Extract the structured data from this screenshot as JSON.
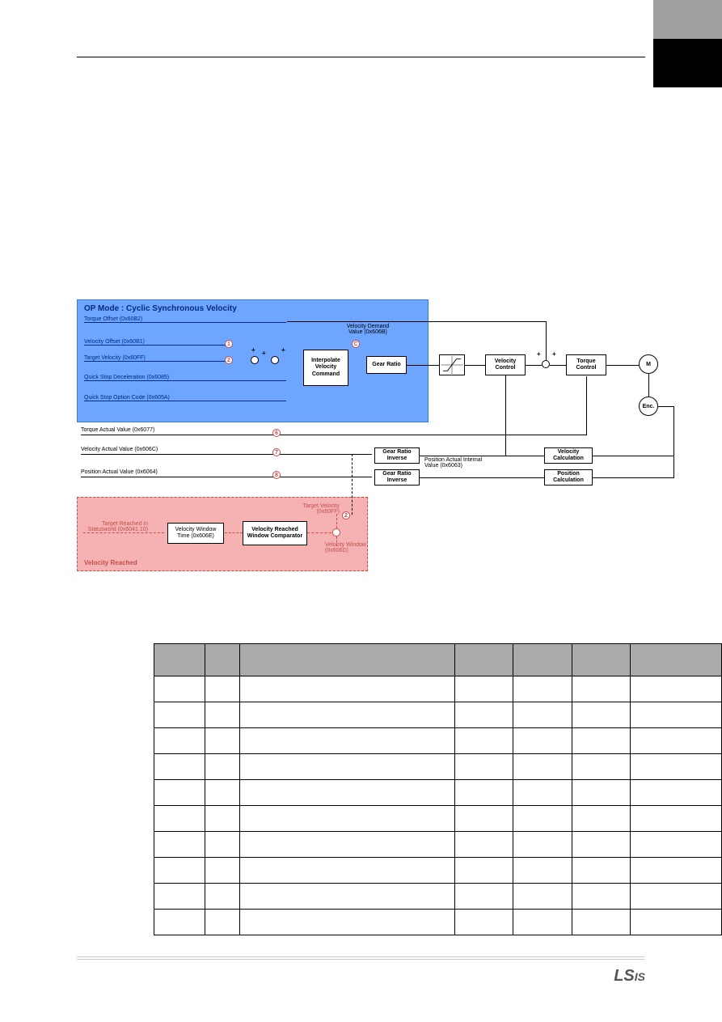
{
  "header_box_gray": "",
  "diagram": {
    "title": "OP Mode : Cyclic Synchronous Velocity",
    "torque_offset": "Torque Offset (0x60B2)",
    "velocity_offset": "Velocity Offset (0x60B1)",
    "target_velocity": "Target Velocity (0x60FF)",
    "quick_stop_decel": "Quick Stop Deceleration (0x6085)",
    "quick_stop_option": "Quick Stop Option Code (0x605A)",
    "velocity_demand": "Velocity Demand Value (0x606B)",
    "interpolate_box": "Interpolate Velocity Command",
    "gear_ratio": "Gear Ratio",
    "velocity_control": "Velocity Control",
    "torque_control": "Torque Control",
    "m_circle": "M",
    "enc_circle": "Enc.",
    "torque_actual": "Torque Actual Value (0x6077)",
    "velocity_actual": "Velocity Actual Value (0x606C)",
    "position_actual": "Position Actual Value (0x6064)",
    "gear_ratio_inverse": "Gear Ratio Inverse",
    "position_actual_internal": "Position Actual Internal Value (0x6063)",
    "velocity_calculation": "Velocity Calculation",
    "position_calculation": "Position Calculation",
    "target_reached_status": "Target Reached in Statusword (0x6041.10)",
    "velocity_window_time": "Velocity Window Time (0x606E)",
    "velocity_reached_comparator": "Velocity Reached Window Comparator",
    "target_velocity_0x60ff": "Target Velocity (0x60FF)",
    "velocity_window": "Velocity Window (0x606D)",
    "velocity_reached_title": "Velocity Reached",
    "b1": "1",
    "b2": "2",
    "bc": "C",
    "b6": "6",
    "b7": "7",
    "b8": "8",
    "b2b": "2"
  },
  "table": {
    "rows": 10
  }
}
